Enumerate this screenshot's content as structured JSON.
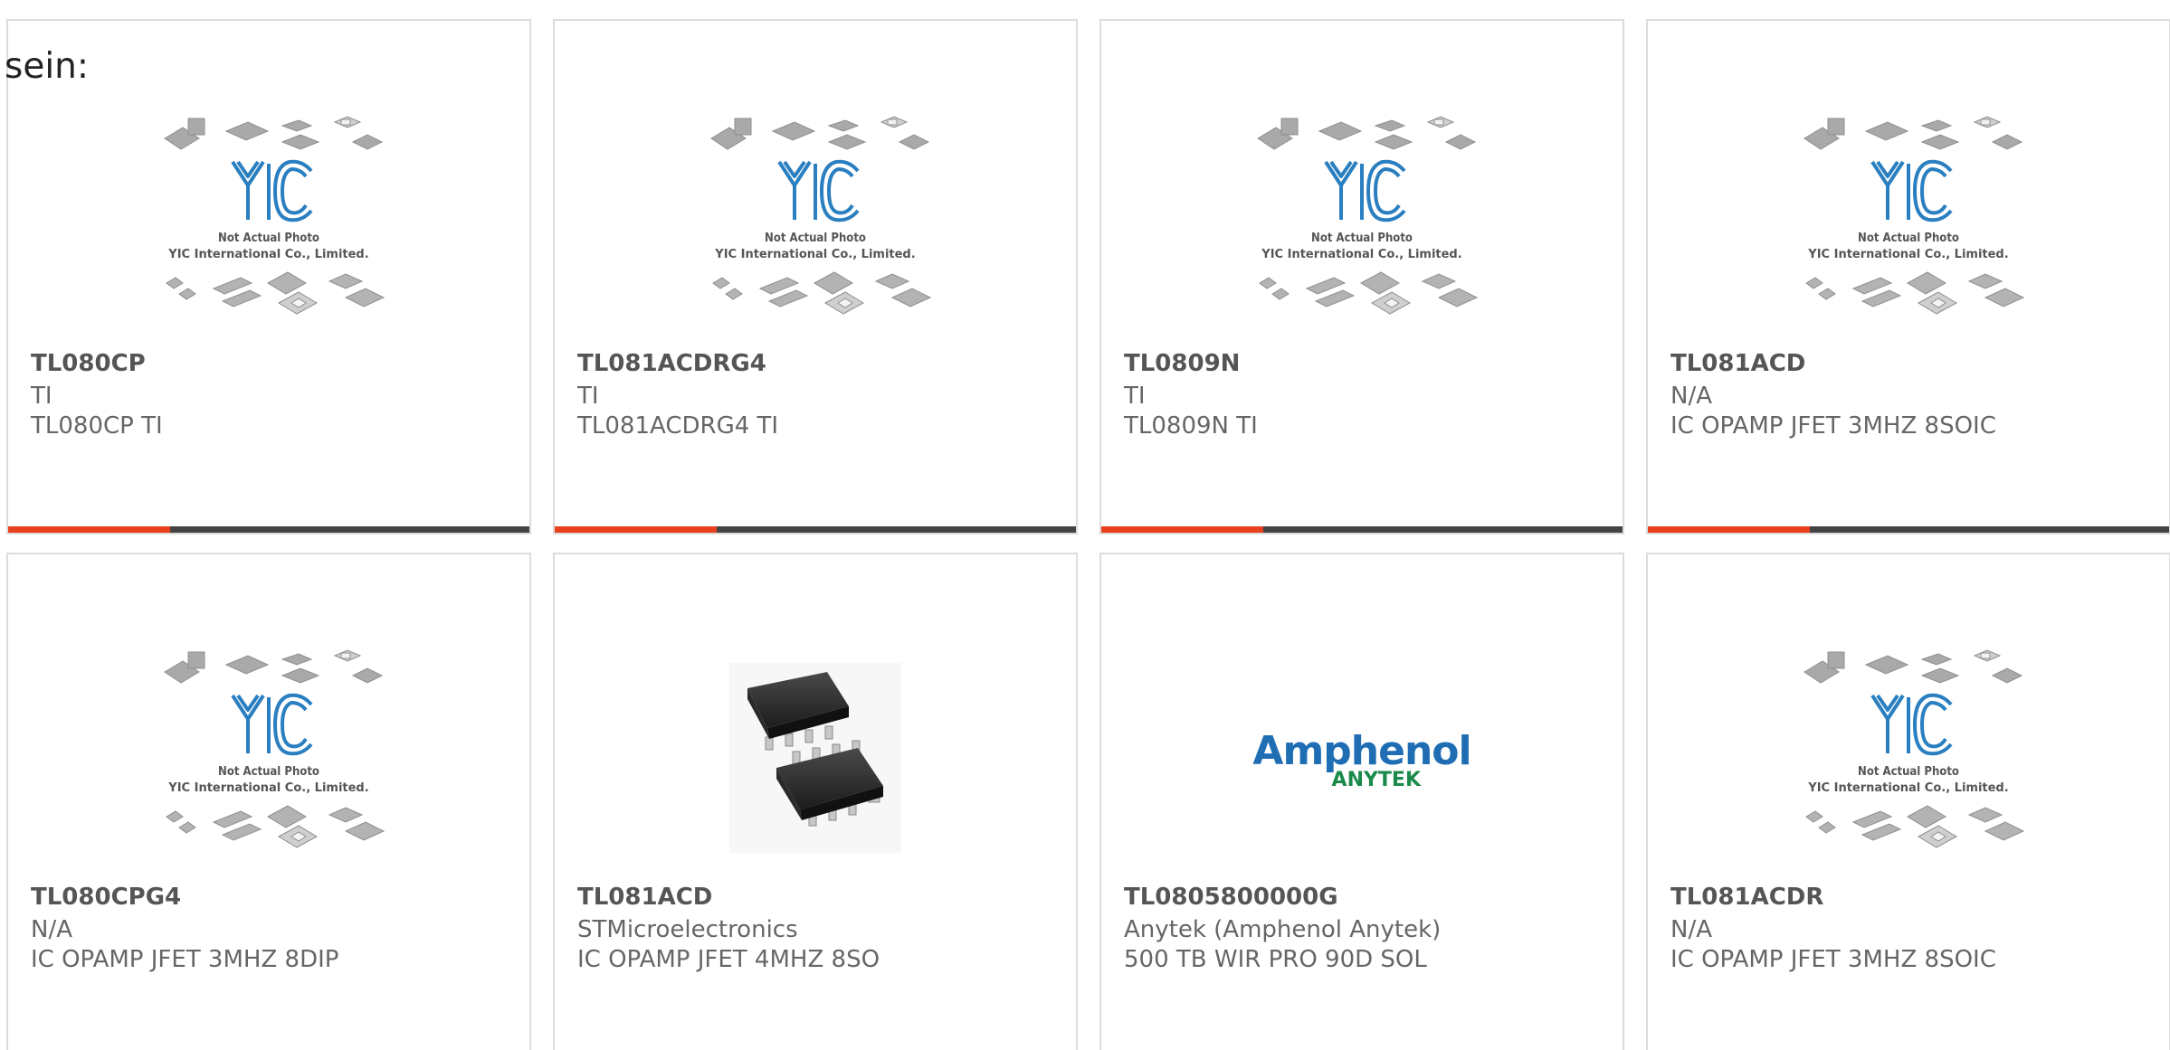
{
  "header": {
    "text": "sein:"
  },
  "colors": {
    "accent": "#e8401c",
    "bar": "#444444",
    "border": "#dcdcdc",
    "logo_blue": "#2a7fc0",
    "amphenol_blue": "#1f6db3",
    "anytek_green": "#1a8a4a"
  },
  "placeholder": {
    "line1": "Not Actual Photo",
    "line2": "YIC International Co., Limited."
  },
  "amphenol_logo": {
    "line1": "Amphenol",
    "line2": "ANYTEK"
  },
  "products": [
    {
      "part": "TL080CP",
      "mfr": "TI",
      "desc": "TL080CP TI",
      "image": "placeholder",
      "progress": 0.31
    },
    {
      "part": "TL081ACDRG4",
      "mfr": "TI",
      "desc": "TL081ACDRG4 TI",
      "image": "placeholder",
      "progress": 0.31
    },
    {
      "part": "TL0809N",
      "mfr": "TI",
      "desc": "TL0809N TI",
      "image": "placeholder",
      "progress": 0.31
    },
    {
      "part": "TL081ACD",
      "mfr": "N/A",
      "desc": "IC OPAMP JFET 3MHZ 8SOIC",
      "image": "placeholder",
      "progress": 0.31
    },
    {
      "part": "TL080CPG4",
      "mfr": "N/A",
      "desc": "IC OPAMP JFET 3MHZ 8DIP",
      "image": "placeholder"
    },
    {
      "part": "TL081ACD",
      "mfr": "STMicroelectronics",
      "desc": "IC OPAMP JFET 4MHZ 8SO",
      "image": "chip-photo"
    },
    {
      "part": "TL0805800000G",
      "mfr": "Anytek (Amphenol Anytek)",
      "desc": "500 TB WIR PRO 90D SOL",
      "image": "amphenol-logo"
    },
    {
      "part": "TL081ACDR",
      "mfr": "N/A",
      "desc": "IC OPAMP JFET 3MHZ 8SOIC",
      "image": "placeholder"
    }
  ]
}
